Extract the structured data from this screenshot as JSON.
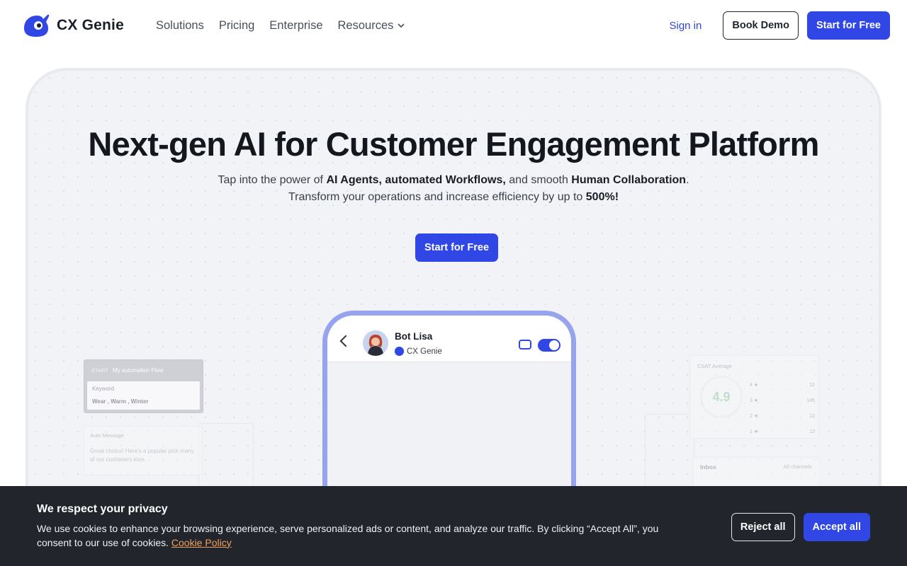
{
  "brand": {
    "name": "CX Genie",
    "logo_icon": "genie-logo-icon",
    "accent": "#3047e5"
  },
  "nav": {
    "menu": [
      {
        "label": "Solutions"
      },
      {
        "label": "Pricing"
      },
      {
        "label": "Enterprise"
      },
      {
        "label": "Resources",
        "icon": "chevron-down-icon"
      }
    ],
    "sign_in": "Sign in",
    "book_demo": "Book Demo",
    "start_free": "Start for Free"
  },
  "hero": {
    "title": "Next-gen AI for Customer Engagement Platform",
    "sub_line1_pre": "Tap into the power of ",
    "sub_line1_b1": "AI Agents, automated Workflows,",
    "sub_line1_mid": " and smooth ",
    "sub_line1_b2": "Human Collaboration",
    "sub_line1_end": ".",
    "sub_line2_pre": "Transform your operations and increase efficiency by up to ",
    "sub_line2_b": "500%!",
    "cta": "Start for Free"
  },
  "phone": {
    "bot_name": "Bot Lisa",
    "bot_brand": "CX Genie",
    "toggle_on": true
  },
  "side_cards": {
    "flow_tag": "START",
    "flow_title": "My automation Flow",
    "flow_keyword_label": "Keyword",
    "flow_keywords": "Wear , Warm , Winter",
    "msg_label": "Auto Message",
    "msg_text": "Great choice! Here's a popular pick many of our customers love.",
    "csat_label": "CSAT Average",
    "csat_value": "4.9",
    "csat_rows": [
      {
        "star": "4",
        "count": "12"
      },
      {
        "star": "3",
        "count": "145"
      },
      {
        "star": "2",
        "count": "12"
      },
      {
        "star": "1",
        "count": "12"
      }
    ],
    "inbox_title": "Inbox",
    "inbox_channels": "All channels"
  },
  "cookie": {
    "title": "We respect your privacy",
    "body": "We use cookies to enhance your browsing experience, serve personalized ads or content, and analyze our traffic. By clicking “Accept All”, you consent to our use of cookies. ",
    "link": "Cookie Policy",
    "reject": "Reject all",
    "accept": "Accept all"
  }
}
